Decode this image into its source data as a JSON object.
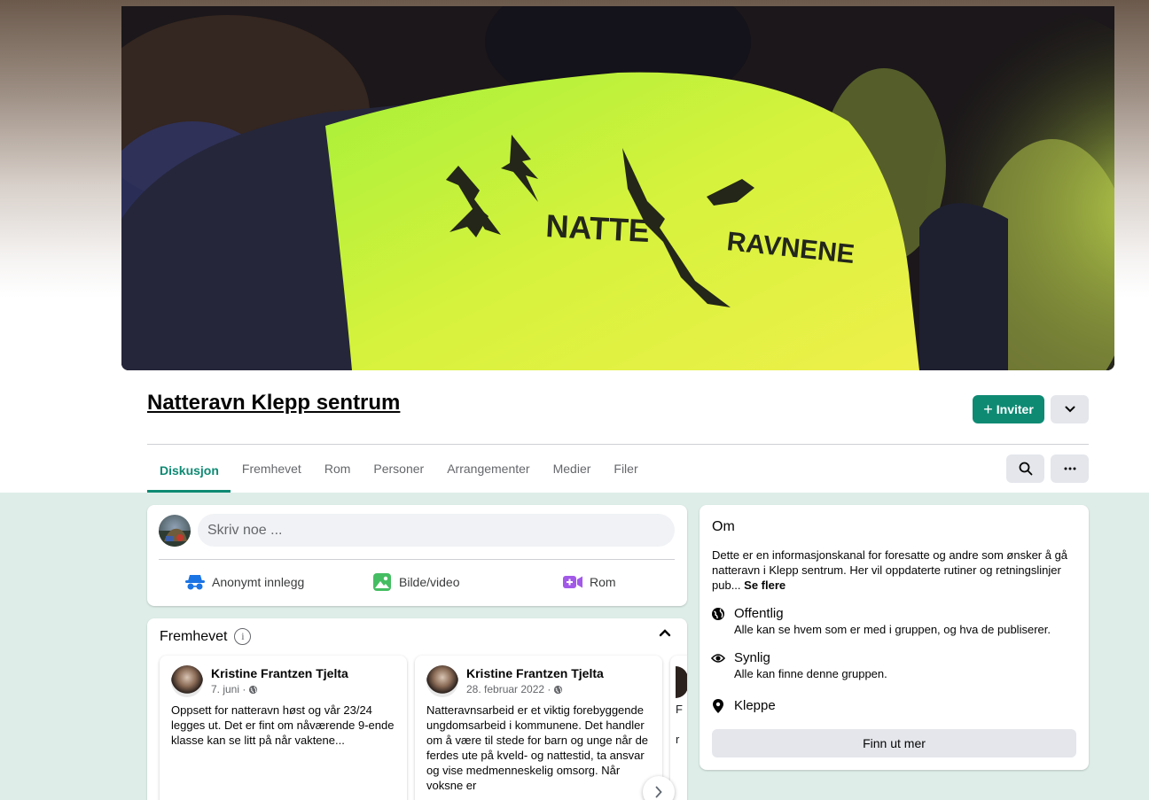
{
  "group": {
    "title": "Natteravn Klepp sentrum",
    "invite_label": "Inviter",
    "cover_vest_text_1": "NATTE",
    "cover_vest_text_2": "RAVNENE"
  },
  "tabs": [
    "Diskusjon",
    "Fremhevet",
    "Rom",
    "Personer",
    "Arrangementer",
    "Medier",
    "Filer"
  ],
  "active_tab": "Diskusjon",
  "composer": {
    "placeholder": "Skriv noe ...",
    "actions": {
      "anonymous": "Anonymt innlegg",
      "photo": "Bilde/video",
      "room": "Rom"
    }
  },
  "featured": {
    "title": "Fremhevet",
    "posts": [
      {
        "author": "Kristine Frantzen Tjelta",
        "date": "7. juni ·",
        "text": "Oppsett for natteravn høst og vår 23/24 legges ut. Det er fint om nåværende 9-ende klasse kan se litt på når vaktene..."
      },
      {
        "author": "Kristine Frantzen Tjelta",
        "date": "28. februar 2022 ·",
        "text": "Natteravnsarbeid er et viktig forebyggende ungdomsarbeid i kommunene. Det handler om å være til stede for barn og unge når de ferdes ute på kveld- og nattestid, ta ansvar og vise medmenneskelig omsorg. Når voksne er"
      }
    ],
    "peek_letters": [
      "F",
      "r"
    ]
  },
  "about": {
    "title": "Om",
    "description": "Dette er en informasjonskanal for foresatte og andre som ønsker å gå natteravn i Klepp sentrum. Her vil oppdaterte rutiner og retningslinjer pub...",
    "see_more": "Se flere",
    "public_title": "Offentlig",
    "public_desc": "Alle kan se hvem som er med i gruppen, og hva de publiserer.",
    "visible_title": "Synlig",
    "visible_desc": "Alle kan finne denne gruppen.",
    "location": "Kleppe",
    "find_more": "Finn ut mer"
  },
  "colors": {
    "accent": "#0e8a73",
    "content_bg": "#deede8",
    "button_gray": "#e4e6eb"
  },
  "icons": [
    "globe-icon",
    "eye-icon",
    "map-pin-icon",
    "search-icon",
    "more-icon",
    "chevron-down-icon",
    "chevron-up-icon",
    "chevron-right-icon",
    "info-icon",
    "incognito-icon",
    "photo-icon",
    "video-room-icon"
  ]
}
